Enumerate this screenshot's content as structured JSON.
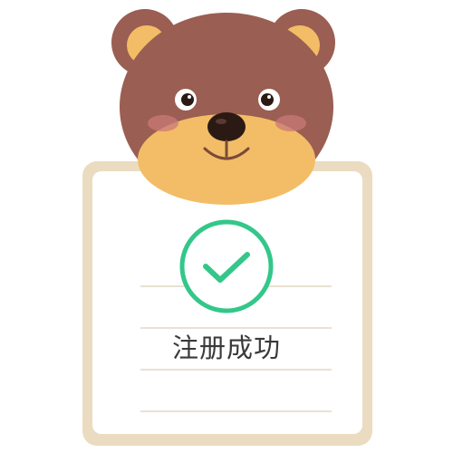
{
  "status": {
    "message": "注册成功"
  },
  "colors": {
    "success_green": "#33c78a",
    "card_border": "#ebdcc1",
    "bear_brown": "#9a5e52",
    "bear_muzzle": "#f2bd66"
  },
  "icons": {
    "mascot": "bear-mascot-icon",
    "status": "checkmark-circle-icon"
  }
}
